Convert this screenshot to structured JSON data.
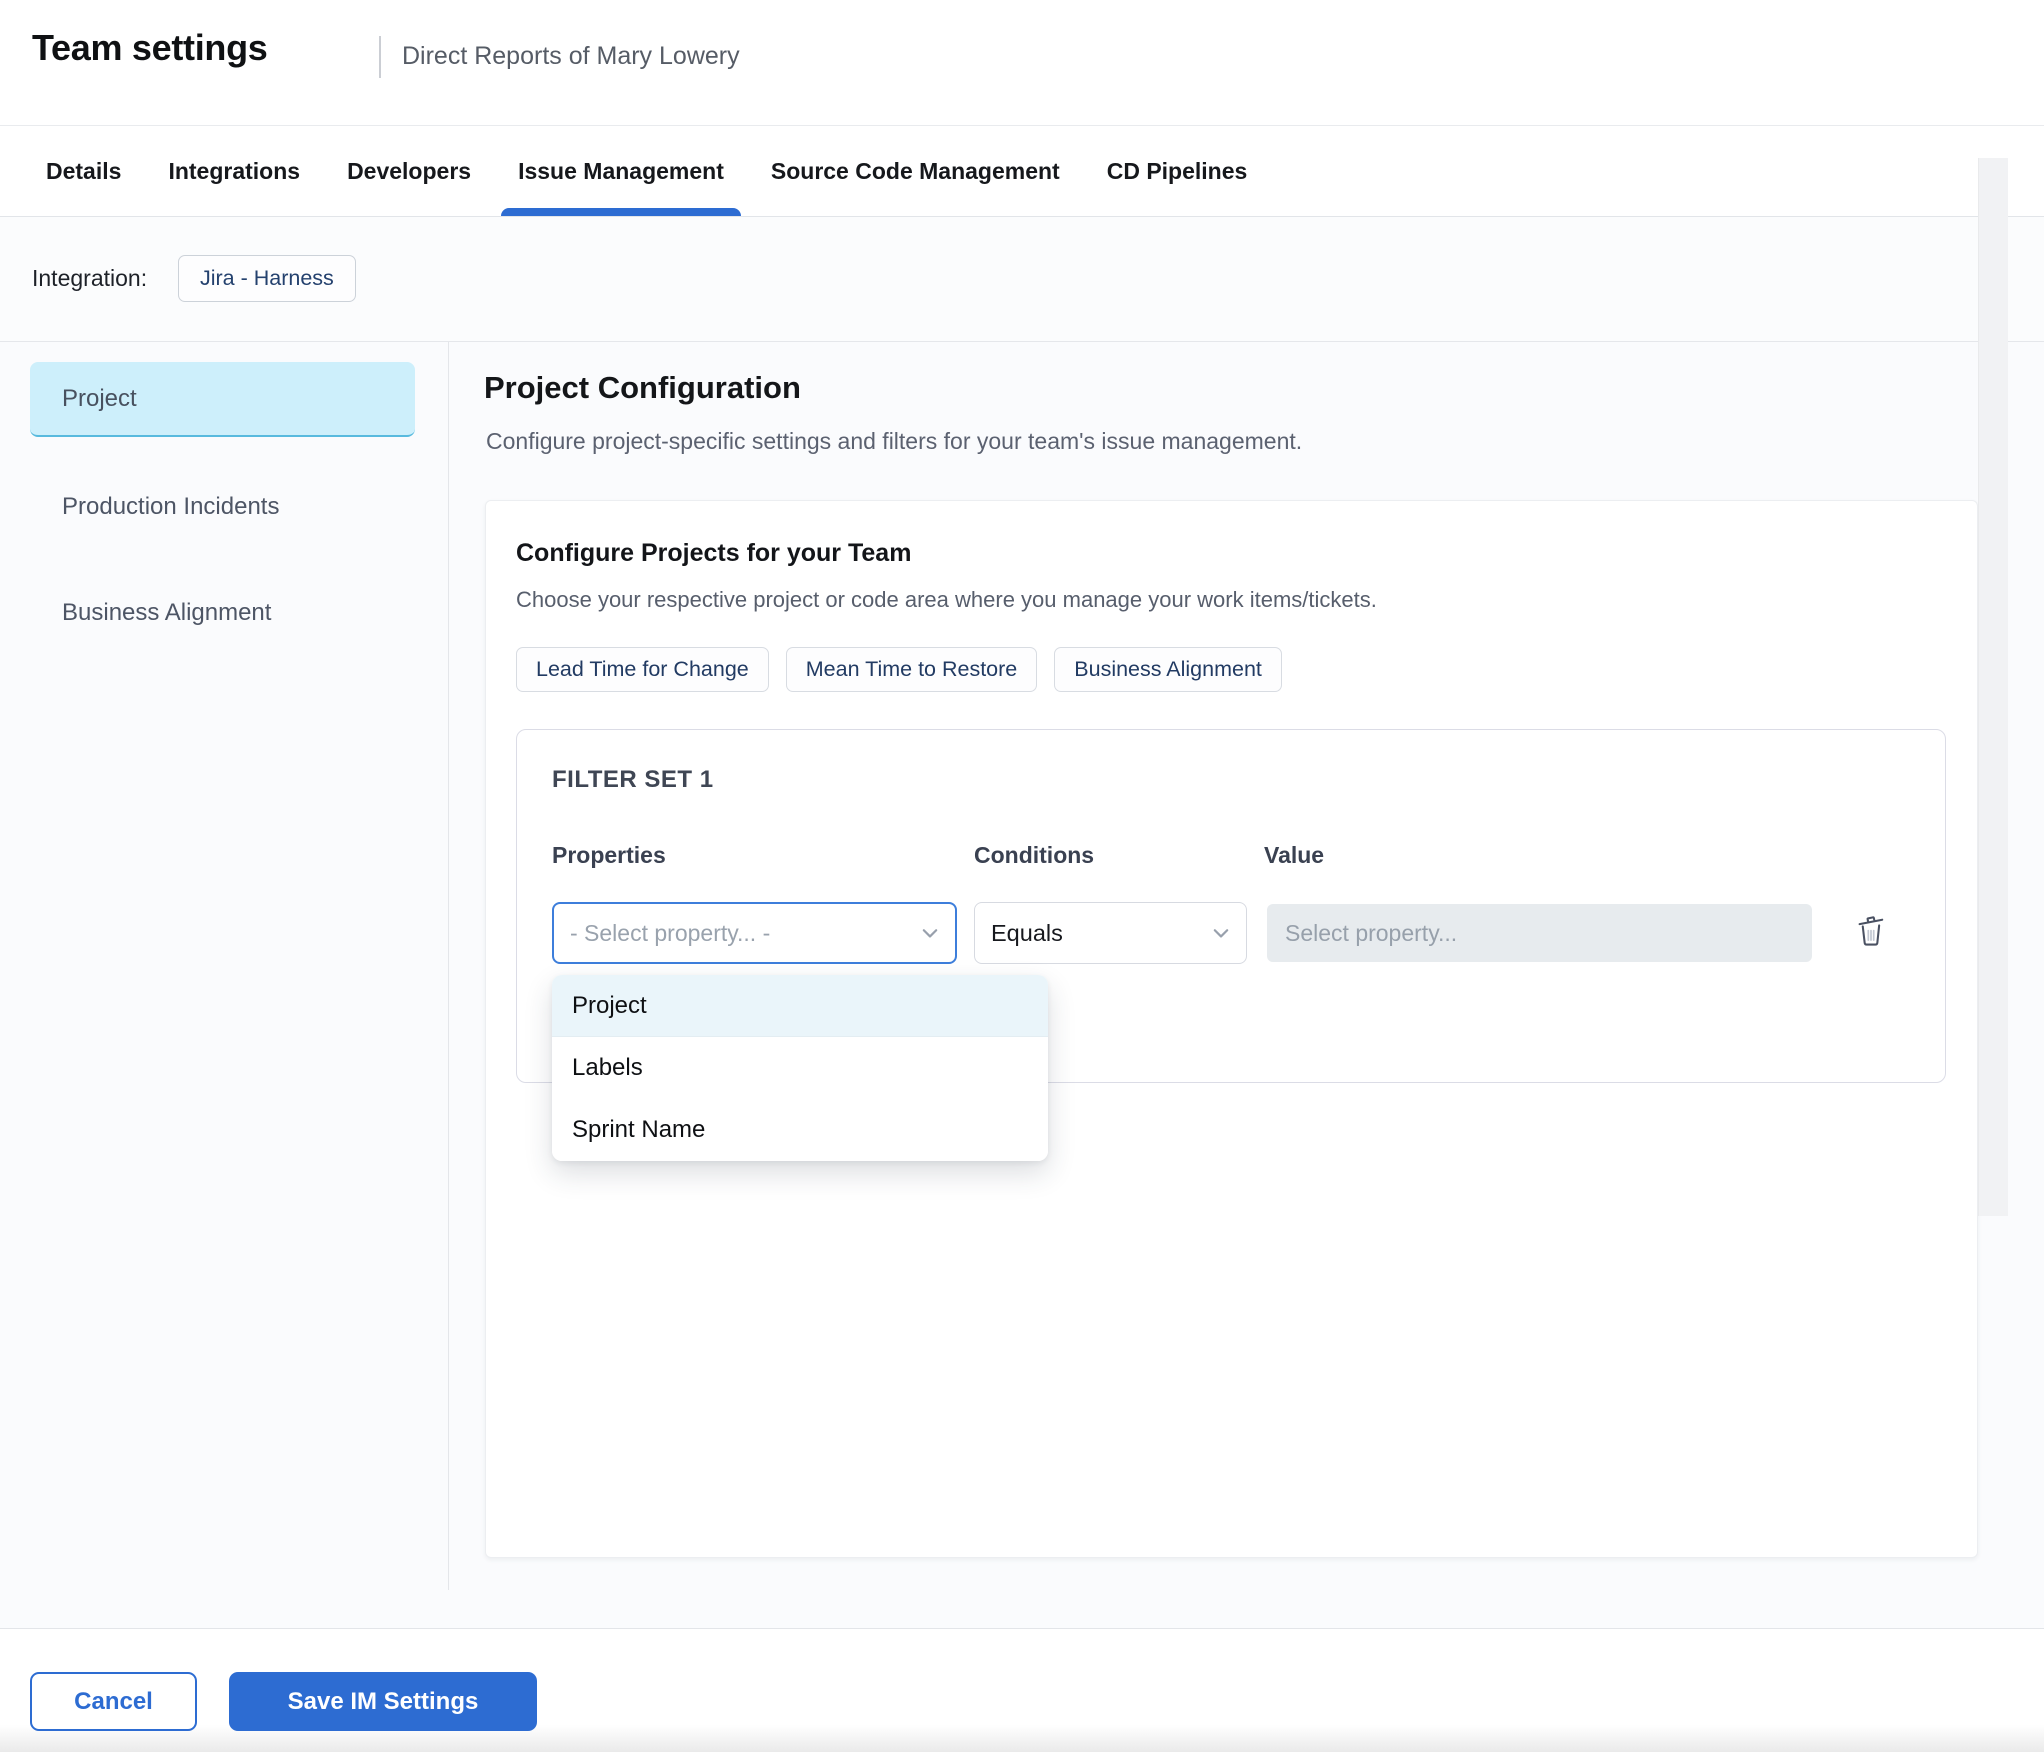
{
  "colors": {
    "primary": "#2d6cd2",
    "focus-border": "#3d7edb",
    "sidebar-active-bg": "#cdeffb",
    "sidebar-active-border": "#58bade",
    "dropdown-highlight": "#eaf5fa",
    "chip-text": "#223b63",
    "value-bg": "#e7ebee"
  },
  "header": {
    "title": "Team settings",
    "subtitle": "Direct Reports of Mary Lowery"
  },
  "tabs": [
    {
      "label": "Details",
      "active": false
    },
    {
      "label": "Integrations",
      "active": false
    },
    {
      "label": "Developers",
      "active": false
    },
    {
      "label": "Issue Management",
      "active": true
    },
    {
      "label": "Source Code Management",
      "active": false
    },
    {
      "label": "CD Pipelines",
      "active": false
    }
  ],
  "integration": {
    "label": "Integration:",
    "chip": "Jira - Harness"
  },
  "sidebar": {
    "items": [
      {
        "label": "Project",
        "active": true
      },
      {
        "label": "Production Incidents",
        "active": false
      },
      {
        "label": "Business Alignment",
        "active": false
      }
    ]
  },
  "main": {
    "title": "Project Configuration",
    "subtitle": "Configure project-specific settings and filters for your team's issue management.",
    "card": {
      "title": "Configure Projects for your Team",
      "subtitle": "Choose your respective project or code area where you manage your work items/tickets.",
      "chips": [
        {
          "label": "Lead Time for Change"
        },
        {
          "label": "Mean Time to Restore"
        },
        {
          "label": "Business Alignment"
        }
      ],
      "filter_set": {
        "title": "FILTER SET 1",
        "columns": [
          "Properties",
          "Conditions",
          "Value"
        ],
        "properties_value": "- Select property... -",
        "conditions_value": "Equals",
        "value_placeholder": "Select property...",
        "dropdown_options": [
          {
            "label": "Project",
            "highlighted": true
          },
          {
            "label": "Labels",
            "highlighted": false
          },
          {
            "label": "Sprint Name",
            "highlighted": false
          }
        ]
      }
    }
  },
  "footer": {
    "cancel_label": "Cancel",
    "save_label": "Save IM Settings"
  }
}
